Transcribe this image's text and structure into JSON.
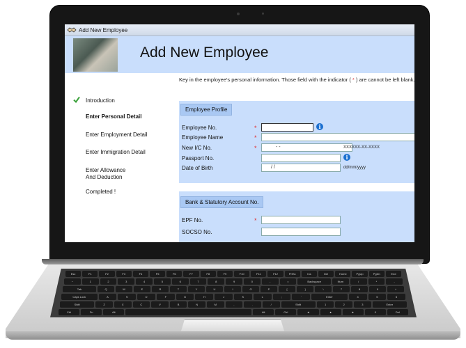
{
  "window": {
    "title": "Add New Employee"
  },
  "header": {
    "title": "Add New Employee"
  },
  "nav": {
    "items": [
      {
        "label": "Introduction",
        "state": "done"
      },
      {
        "label": "Enter Personal Detail",
        "state": "active"
      },
      {
        "label": "Enter Employment Detail",
        "state": "pending"
      },
      {
        "label": "Enter Immigration Detail",
        "state": "pending"
      },
      {
        "label": "Enter Allowance",
        "label2": "And Deduction",
        "state": "pending"
      },
      {
        "label": "Completed !",
        "state": "pending"
      }
    ]
  },
  "intro": {
    "text1": "Key in the employee's personal information. Those field with the indicator (",
    "mark": " * ",
    "text2": ") are cannot be left blank."
  },
  "profile": {
    "tab": "Employee Profile",
    "fields": {
      "employee_no": {
        "label": "Employee No.",
        "value": ""
      },
      "employee_name": {
        "label": "Employee Name",
        "value": ""
      },
      "new_ic": {
        "label": "New I/C No.",
        "value": "-   -",
        "hint": "XXXXXX-XX-XXXX"
      },
      "passport": {
        "label": "Passport No.",
        "value": ""
      },
      "dob": {
        "label": "Date of Birth",
        "value": "/  /",
        "hint": "dd/mm/yyyy"
      }
    },
    "required_mark": "*"
  },
  "bank": {
    "tab": "Bank & Statutory Account No.",
    "fields": {
      "epf": {
        "label": "EPF No.",
        "value": ""
      },
      "socso": {
        "label": "SOCSO No.",
        "value": ""
      }
    }
  },
  "keyboard": {
    "rows": [
      [
        "Esc",
        "F1",
        "F2",
        "F3",
        "F4",
        "F5",
        "F6",
        "F7",
        "F8",
        "F9",
        "F10",
        "F11",
        "F12",
        "PrtSc",
        "Ins",
        "Del",
        "Home",
        "PgUp",
        "PgDn",
        "End"
      ],
      [
        "~",
        "1",
        "2",
        "3",
        "4",
        "5",
        "6",
        "7",
        "8",
        "9",
        "0",
        "-",
        "=",
        "Backspace",
        "Num",
        "/",
        "*",
        "-"
      ],
      [
        "Tab",
        "Q",
        "W",
        "E",
        "R",
        "T",
        "Y",
        "U",
        "I",
        "O",
        "P",
        "[",
        "]",
        "\\",
        "7",
        "8",
        "9",
        "+"
      ],
      [
        "Caps Lock",
        "A",
        "S",
        "D",
        "F",
        "G",
        "H",
        "J",
        "K",
        "L",
        ";",
        "'",
        "Enter",
        "4",
        "5",
        "6"
      ],
      [
        "Shift",
        "Z",
        "X",
        "C",
        "V",
        "B",
        "N",
        "M",
        ",",
        ".",
        "/",
        "Shift",
        "1",
        "2",
        "3",
        "Enter"
      ],
      [
        "Ctrl",
        "Fn",
        "Alt",
        "",
        "Alt",
        "Ctrl",
        "◄",
        "▲",
        "►",
        "0",
        "Del"
      ]
    ]
  },
  "colors": {
    "header_bg": "#c9defc",
    "section_bg": "#c9defc",
    "required": "#e03030",
    "check": "#3aa13a",
    "info": "#1a6fd0"
  }
}
